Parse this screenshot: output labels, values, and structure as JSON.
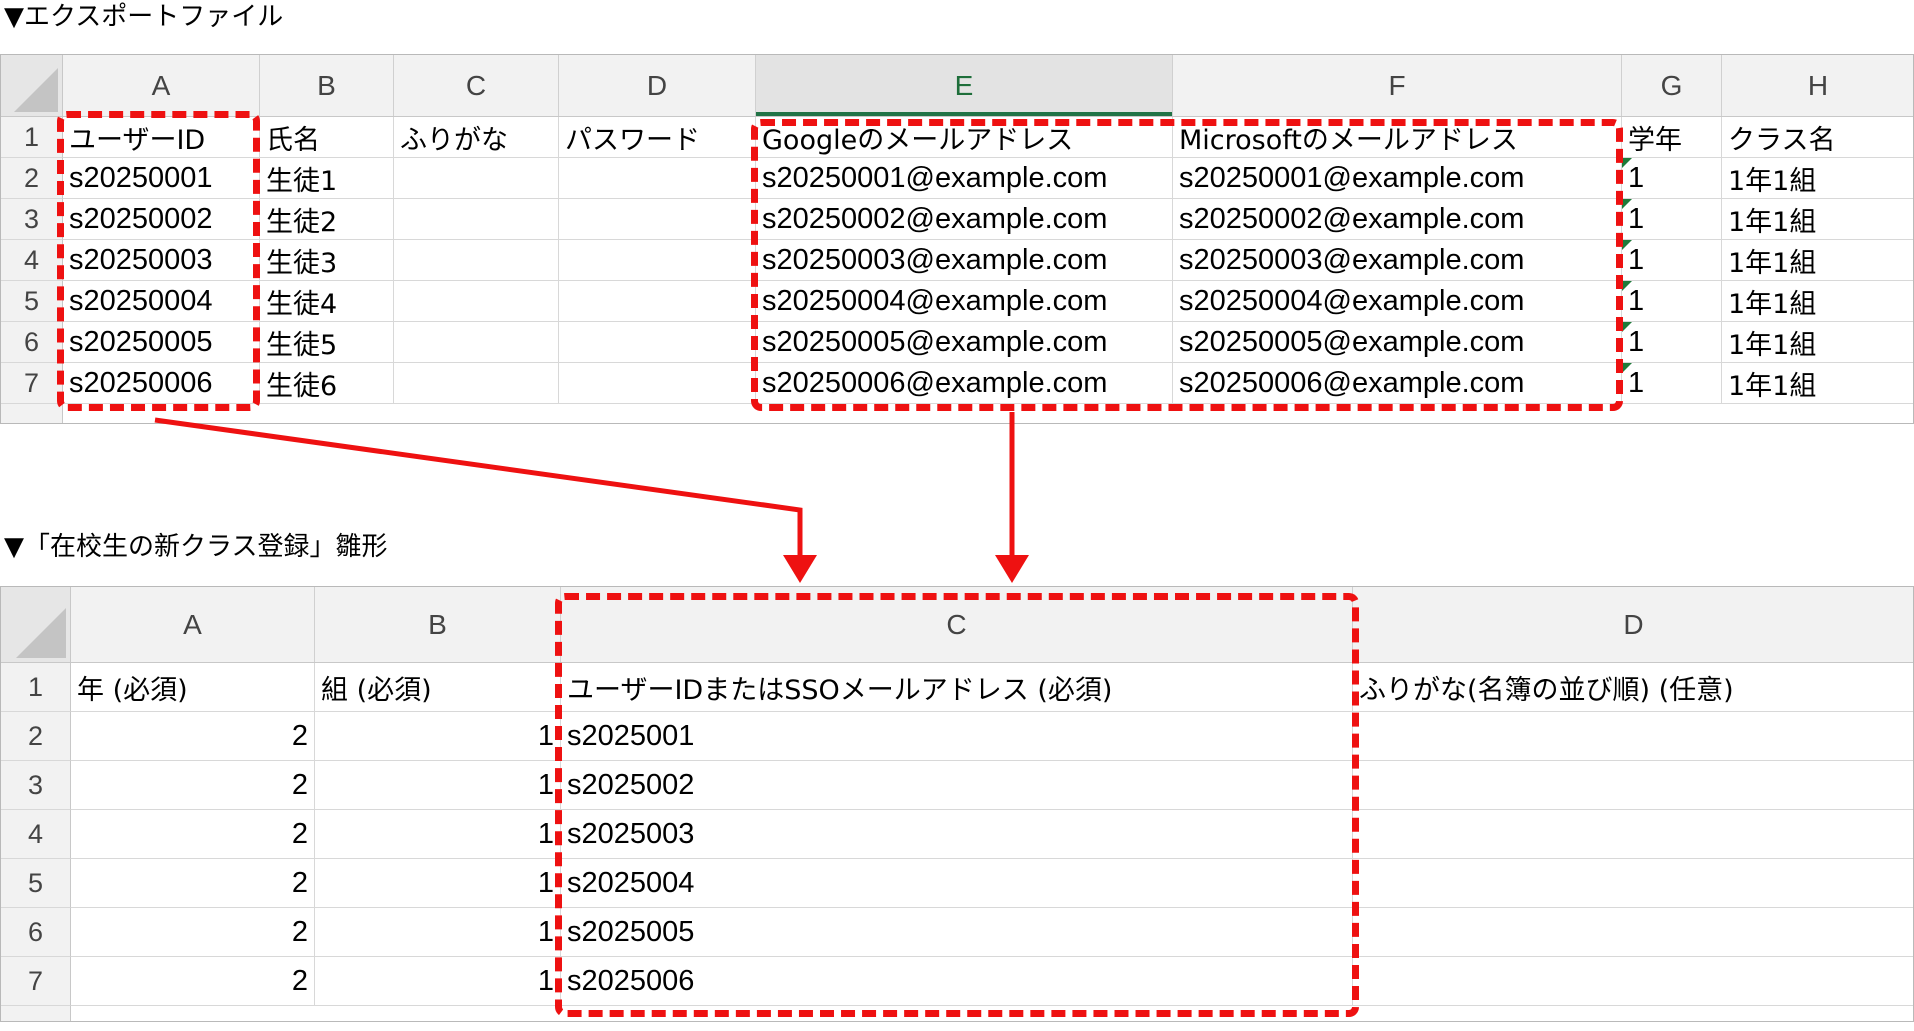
{
  "export": {
    "title": "▼エクスポートファイル",
    "columns": [
      "A",
      "B",
      "C",
      "D",
      "E",
      "F",
      "G",
      "H"
    ],
    "active_column": "E",
    "headers": [
      "ユーザーID",
      "氏名",
      "ふりがな",
      "パスワード",
      "Googleのメールアドレス",
      "Microsoftのメールアドレス",
      "学年",
      "クラス名"
    ],
    "rows": [
      {
        "num": "2",
        "id": "s20250001",
        "name": "生徒1",
        "kana": "",
        "pw": "",
        "google": "s20250001@example.com",
        "ms": "s20250001@example.com",
        "grade": "1",
        "cls": "1年1組"
      },
      {
        "num": "3",
        "id": "s20250002",
        "name": "生徒2",
        "kana": "",
        "pw": "",
        "google": "s20250002@example.com",
        "ms": "s20250002@example.com",
        "grade": "1",
        "cls": "1年1組"
      },
      {
        "num": "4",
        "id": "s20250003",
        "name": "生徒3",
        "kana": "",
        "pw": "",
        "google": "s20250003@example.com",
        "ms": "s20250003@example.com",
        "grade": "1",
        "cls": "1年1組"
      },
      {
        "num": "5",
        "id": "s20250004",
        "name": "生徒4",
        "kana": "",
        "pw": "",
        "google": "s20250004@example.com",
        "ms": "s20250004@example.com",
        "grade": "1",
        "cls": "1年1組"
      },
      {
        "num": "6",
        "id": "s20250005",
        "name": "生徒5",
        "kana": "",
        "pw": "",
        "google": "s20250005@example.com",
        "ms": "s20250005@example.com",
        "grade": "1",
        "cls": "1年1組"
      },
      {
        "num": "7",
        "id": "s20250006",
        "name": "生徒6",
        "kana": "",
        "pw": "",
        "google": "s20250006@example.com",
        "ms": "s20250006@example.com",
        "grade": "1",
        "cls": "1年1組"
      }
    ]
  },
  "template": {
    "title": "▼「在校生の新クラス登録」雛形",
    "columns": [
      "A",
      "B",
      "C",
      "D"
    ],
    "headers": [
      "年 (必須)",
      "組 (必須)",
      "ユーザーIDまたはSSOメールアドレス (必須)",
      "ふりがな(名簿の並び順) (任意)"
    ],
    "rows": [
      {
        "num": "2",
        "year": "2",
        "group": "1",
        "id": "s2025001",
        "kana": ""
      },
      {
        "num": "3",
        "year": "2",
        "group": "1",
        "id": "s2025002",
        "kana": ""
      },
      {
        "num": "4",
        "year": "2",
        "group": "1",
        "id": "s2025003",
        "kana": ""
      },
      {
        "num": "5",
        "year": "2",
        "group": "1",
        "id": "s2025004",
        "kana": ""
      },
      {
        "num": "6",
        "year": "2",
        "group": "1",
        "id": "s2025005",
        "kana": ""
      },
      {
        "num": "7",
        "year": "2",
        "group": "1",
        "id": "s2025006",
        "kana": ""
      }
    ]
  },
  "row_header_label": "1",
  "colors": {
    "highlight": "#ee1111",
    "active_col": "#217346",
    "error_marker": "#1e7b3a"
  }
}
